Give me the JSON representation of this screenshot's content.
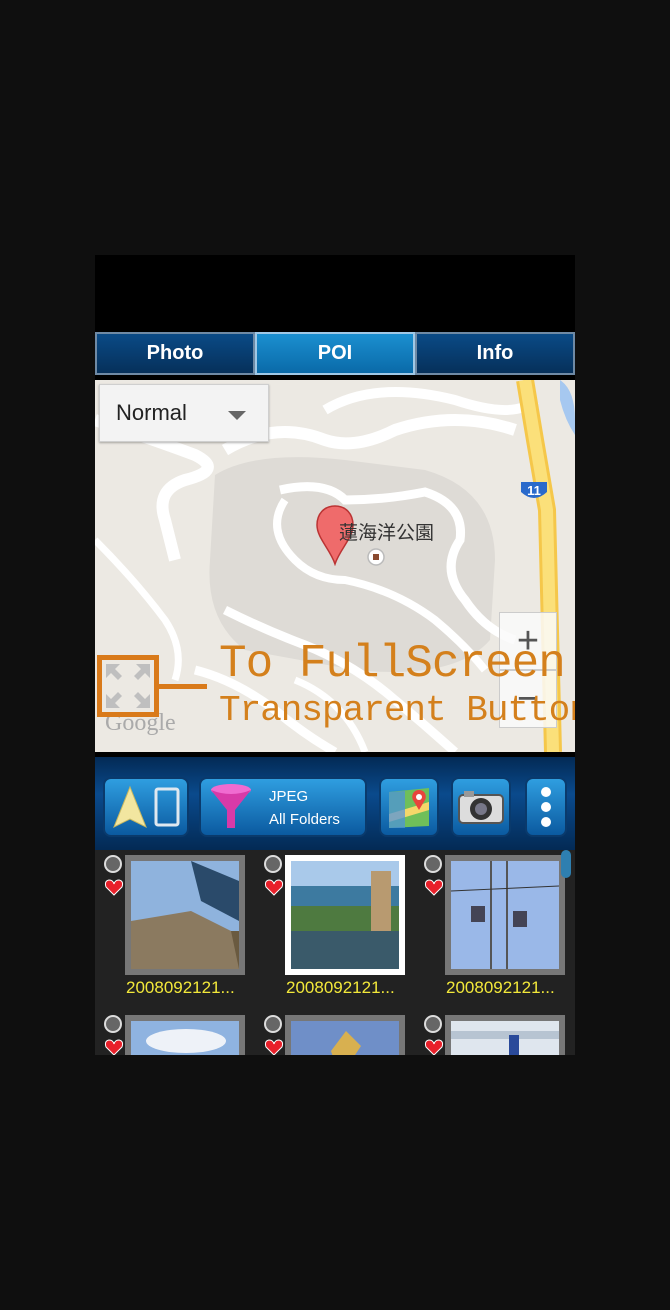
{
  "tabs": [
    {
      "label": "Photo",
      "active": false
    },
    {
      "label": "POI",
      "active": true
    },
    {
      "label": "Info",
      "active": false
    }
  ],
  "map": {
    "type_select": "Normal",
    "poi_label": "蓮海洋公園",
    "route_shield": "11",
    "zoom_in": "+",
    "zoom_out": "−",
    "attribution": "Google"
  },
  "annotation": {
    "line1": "To FullScreen",
    "line2": "Transparent Button",
    "color": "#d97a1a"
  },
  "toolbar": {
    "filter_line1": "JPEG",
    "filter_line2": "All Folders"
  },
  "thumbnails": [
    {
      "filename": "2008092121...",
      "selected": false
    },
    {
      "filename": "2008092121...",
      "selected": true
    },
    {
      "filename": "2008092121...",
      "selected": false
    },
    {
      "filename": "",
      "selected": false
    },
    {
      "filename": "",
      "selected": false
    },
    {
      "filename": "",
      "selected": false
    }
  ]
}
